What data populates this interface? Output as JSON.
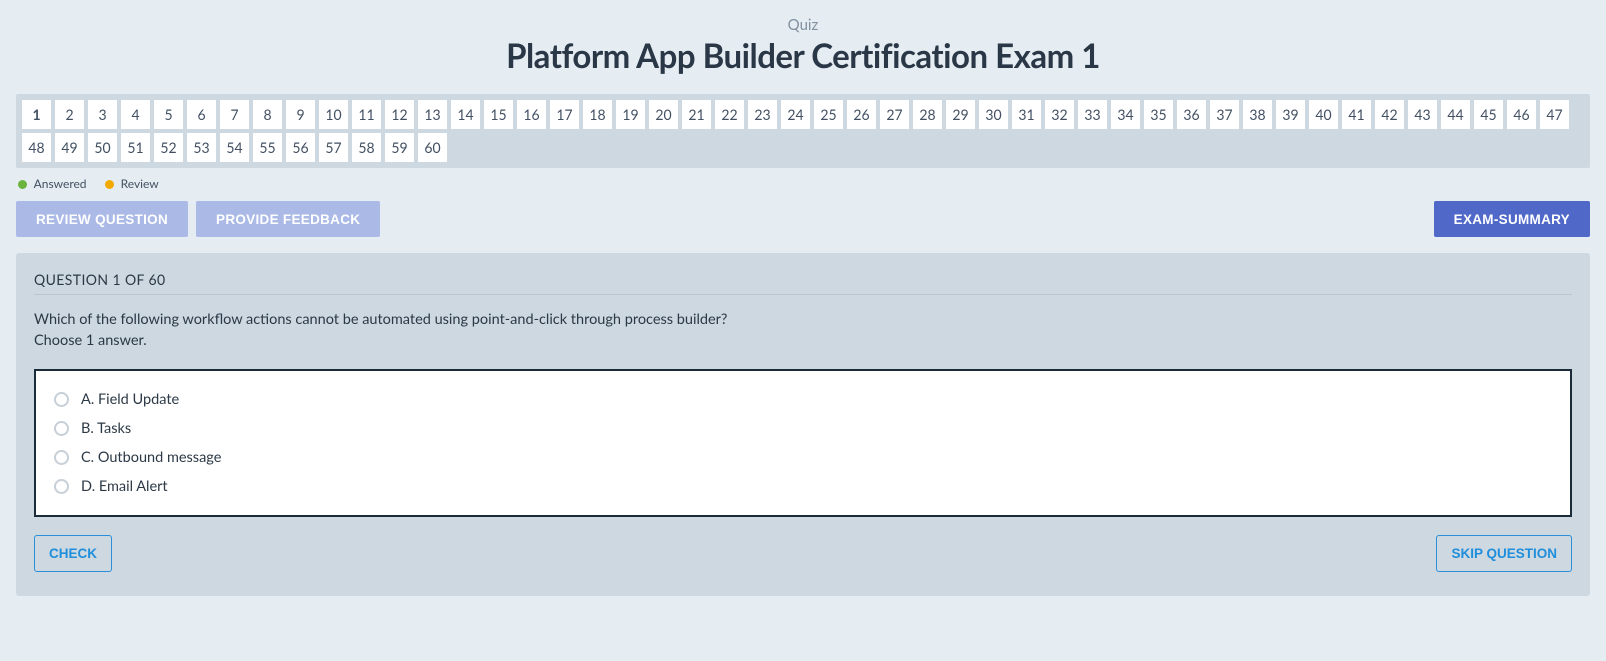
{
  "header": {
    "subtitle": "Quiz",
    "title": "Platform App Builder Certification Exam 1"
  },
  "nav": {
    "total": 60,
    "current": 1,
    "numbers": [
      1,
      2,
      3,
      4,
      5,
      6,
      7,
      8,
      9,
      10,
      11,
      12,
      13,
      14,
      15,
      16,
      17,
      18,
      19,
      20,
      21,
      22,
      23,
      24,
      25,
      26,
      27,
      28,
      29,
      30,
      31,
      32,
      33,
      34,
      35,
      36,
      37,
      38,
      39,
      40,
      41,
      42,
      43,
      44,
      45,
      46,
      47,
      48,
      49,
      50,
      51,
      52,
      53,
      54,
      55,
      56,
      57,
      58,
      59,
      60
    ]
  },
  "legend": {
    "answered": "Answered",
    "review": "Review"
  },
  "actions": {
    "review_question": "REVIEW QUESTION",
    "provide_feedback": "PROVIDE FEEDBACK",
    "exam_summary": "EXAM-SUMMARY"
  },
  "question": {
    "header": "QUESTION 1 OF 60",
    "prompt": "Which of the following workflow actions cannot be automated using point-and-click through process builder?",
    "instruction": "Choose 1 answer.",
    "answers": [
      {
        "key": "A",
        "text": "A. Field Update"
      },
      {
        "key": "B",
        "text": "B. Tasks"
      },
      {
        "key": "C",
        "text": "C. Outbound message"
      },
      {
        "key": "D",
        "text": "D. Email Alert"
      }
    ]
  },
  "footer": {
    "check": "CHECK",
    "skip": "SKIP QUESTION"
  }
}
